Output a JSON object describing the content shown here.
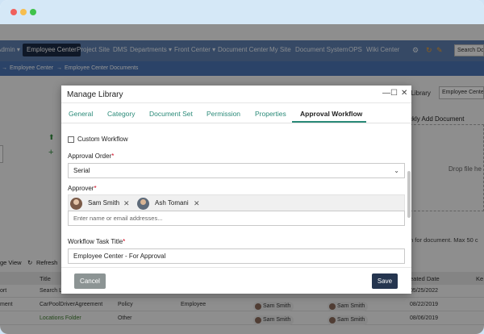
{
  "topnav": {
    "items": [
      "Admin ▾",
      "Project Site",
      "DMS",
      "Departments ▾",
      "Front Center ▾",
      "Document Center",
      "My Site",
      "Document System",
      "OPS",
      "Wiki Center"
    ],
    "active": "Employee Center",
    "search_placeholder": "Search Do"
  },
  "breadcrumb": [
    "Employee Center",
    "Employee Center Documents"
  ],
  "background": {
    "library_label": "t Library",
    "library_value": "Employee Center",
    "quick_add": "ckly Add Document",
    "drop_text": "Drop file he",
    "upload_note": "n for document. Max 50 c",
    "toolbar": {
      "view": "ge View",
      "refresh": "Refresh"
    },
    "table": {
      "headers": [
        "Title",
        "eated Date",
        "Ke"
      ],
      "rows": [
        {
          "col0": "ort",
          "title": "Search Li",
          "date": "05/25/2022",
          "c3": "",
          "c4": "",
          "p1": "",
          "p2": ""
        },
        {
          "col0": "ment",
          "title": "CarPoolDriverAgreement",
          "c3": "Policy",
          "c4": "Employee",
          "p1": "Sam Smith",
          "p2": "Sam Smith",
          "date": "08/22/2019"
        },
        {
          "col0": "",
          "title": "Locations Folder",
          "c3": "Other",
          "c4": "",
          "p1": "Sam Smith",
          "p2": "Sam Smith",
          "date": "08/06/2019"
        },
        {
          "col0": "",
          "title": "",
          "c3": "",
          "c4": "",
          "p1": "",
          "p2": "",
          "date": ""
        }
      ]
    }
  },
  "modal": {
    "title": "Manage Library",
    "controls": {
      "minimize": "—",
      "maximize": "☐",
      "close": "✕"
    },
    "tabs": [
      "General",
      "Category",
      "Document Set",
      "Permission",
      "Properties",
      "Approval Workflow"
    ],
    "active_tab": "Approval Workflow",
    "custom_workflow_label": "Custom Workflow",
    "custom_workflow_checked": false,
    "approval_order": {
      "label": "Approval Order",
      "value": "Serial"
    },
    "approver": {
      "label": "Approver",
      "tags": [
        "Sam Smith",
        "Ash Tomani"
      ],
      "placeholder": "Enter name or email addresses..."
    },
    "workflow_task_title": {
      "label": "Workflow Task Title",
      "value": "Employee Center - For Approval"
    },
    "cancel_label": "Cancel",
    "save_label": "Save",
    "required_mark": "*",
    "remove_mark": "✕",
    "caret": "⌄"
  }
}
